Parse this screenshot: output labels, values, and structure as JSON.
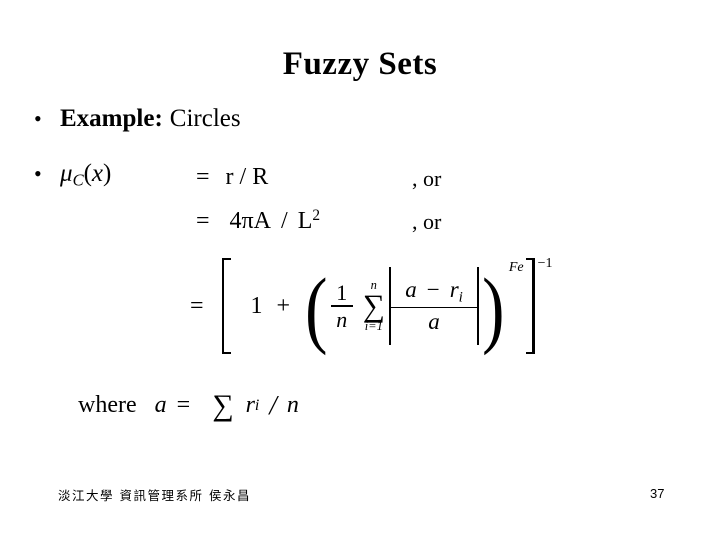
{
  "slide": {
    "title": "Fuzzy Sets",
    "page_number": "37",
    "footer_credit": "淡江大學 資訊管理系所 侯永昌",
    "background_color": "#ffffff",
    "text_color": "#000000"
  },
  "bullets": [
    {
      "marker": "•",
      "label_bold": "Example:",
      "label_normal": "Circles"
    },
    {
      "marker": "•",
      "expr_mu": "μ",
      "expr_sub": "C",
      "expr_open": "(",
      "expr_var": "x",
      "expr_close": ")"
    }
  ],
  "equations": {
    "line1": {
      "equals": "=",
      "rhs": "r / R",
      "trailing": ", or"
    },
    "line2": {
      "equals": "=",
      "coefficient": "4",
      "pi": "π",
      "area": "A",
      "slash": "/",
      "length": "L",
      "exponent": "2",
      "trailing": ", or"
    },
    "big": {
      "equals": "=",
      "one": "1",
      "plus": "+",
      "frac_num": "1",
      "frac_den": "n",
      "sum_upper": "n",
      "sum_symbol": "∑",
      "sum_lower": "i=1",
      "inner_num_a": "a",
      "inner_minus": "−",
      "inner_r": "r",
      "inner_r_sub": "i",
      "inner_den": "a",
      "paren_exponent": "Fe",
      "bracket_exponent": "−1"
    }
  },
  "where_line": {
    "keyword": "where",
    "variable": "a",
    "equals": "=",
    "sum_symbol": "∑",
    "term": "r",
    "term_sub": "i",
    "slash": "/",
    "divisor": "n"
  }
}
